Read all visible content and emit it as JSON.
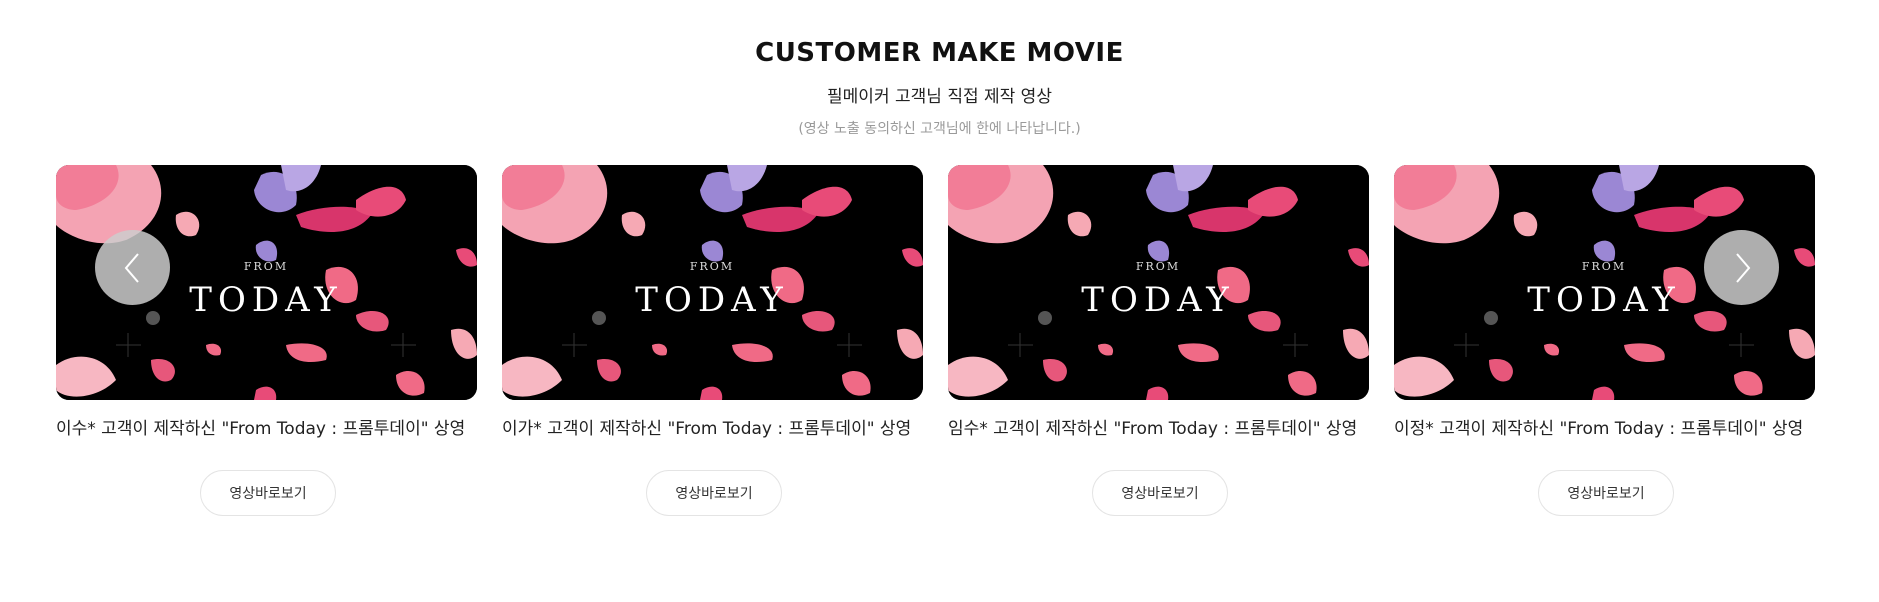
{
  "section": {
    "title": "CUSTOMER MAKE MOVIE",
    "subtitle": "필메이커 고객님 직접 제작 영상",
    "note": "(영상 노출 동의하신 고객님에 한에 나타납니다.)"
  },
  "thumbnail": {
    "small_text": "FROM",
    "big_text": "TODAY"
  },
  "cards": [
    {
      "caption": "이수* 고객이 제작하신 \"From Today : 프롬투데이\" 상영",
      "button": "영상바로보기"
    },
    {
      "caption": "이가* 고객이 제작하신 \"From Today : 프롬투데이\" 상영",
      "button": "영상바로보기"
    },
    {
      "caption": "임수* 고객이 제작하신 \"From Today : 프롬투데이\" 상영",
      "button": "영상바로보기"
    },
    {
      "caption": "이정* 고객이 제작하신 \"From Today : 프롬투데이\" 상영",
      "button": "영상바로보기"
    }
  ],
  "icons": {
    "prev": "chevron-left-icon",
    "next": "chevron-right-icon"
  },
  "colors": {
    "petal_pink": "#f06a86",
    "petal_light": "#f6a9b4",
    "petal_purple": "#9b87d4",
    "petal_magenta": "#d8356b",
    "thumb_bg": "#000000"
  }
}
